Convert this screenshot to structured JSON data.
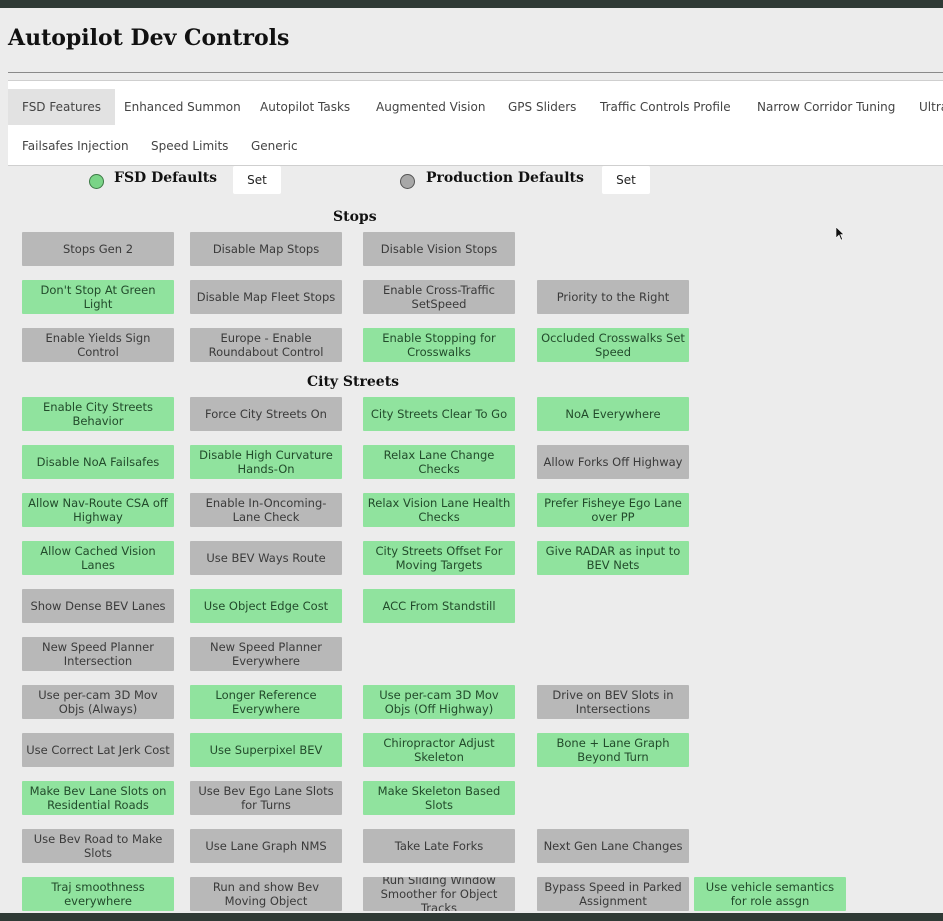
{
  "app": {
    "title": "Autopilot Dev Controls"
  },
  "tabs": [
    "FSD Features",
    "Enhanced Summon",
    "Autopilot Tasks",
    "Augmented Vision",
    "GPS Sliders",
    "Traffic Controls Profile",
    "Narrow Corridor Tuning",
    "Ultra",
    "Failsafes Injection",
    "Speed Limits",
    "Generic"
  ],
  "defaults": {
    "fsd_label": "FSD Defaults",
    "production_label": "Production Defaults",
    "set_label": "Set"
  },
  "sections": {
    "stops": "Stops",
    "city_streets": "City Streets"
  },
  "colors": {
    "enabled": "#90e39e",
    "disabled": "#b8b8b8",
    "accent": "#7ad487"
  },
  "buttons": [
    {
      "label": "Stops Gen 2",
      "enabled": false
    },
    {
      "label": "Disable Map Stops",
      "enabled": false
    },
    {
      "label": "Disable Vision Stops",
      "enabled": false
    },
    {
      "label": "Don't Stop At Green Light",
      "enabled": true
    },
    {
      "label": "Disable Map Fleet Stops",
      "enabled": false
    },
    {
      "label": "Enable Cross-Traffic SetSpeed",
      "enabled": false
    },
    {
      "label": "Priority to the Right",
      "enabled": false
    },
    {
      "label": "Enable Yields Sign Control",
      "enabled": false
    },
    {
      "label": "Europe - Enable Roundabout Control",
      "enabled": false
    },
    {
      "label": "Enable Stopping for Crosswalks",
      "enabled": true
    },
    {
      "label": "Occluded Crosswalks Set Speed",
      "enabled": true
    },
    {
      "label": "Enable City Streets Behavior",
      "enabled": true
    },
    {
      "label": "Force City Streets On",
      "enabled": false
    },
    {
      "label": "City Streets Clear To Go",
      "enabled": true
    },
    {
      "label": "NoA Everywhere",
      "enabled": true
    },
    {
      "label": "Disable NoA Failsafes",
      "enabled": true
    },
    {
      "label": "Disable High Curvature Hands-On",
      "enabled": true
    },
    {
      "label": "Relax Lane Change Checks",
      "enabled": true
    },
    {
      "label": "Allow Forks Off Highway",
      "enabled": false
    },
    {
      "label": "Allow Nav-Route CSA off Highway",
      "enabled": true
    },
    {
      "label": "Enable In-Oncoming-Lane Check",
      "enabled": false
    },
    {
      "label": "Relax Vision Lane Health Checks",
      "enabled": true
    },
    {
      "label": "Prefer Fisheye Ego Lane over PP",
      "enabled": true
    },
    {
      "label": "Allow Cached Vision Lanes",
      "enabled": true
    },
    {
      "label": "Use BEV Ways Route",
      "enabled": false
    },
    {
      "label": "City Streets Offset For Moving Targets",
      "enabled": true
    },
    {
      "label": "Give RADAR as input to BEV Nets",
      "enabled": true
    },
    {
      "label": "Show Dense BEV Lanes",
      "enabled": false
    },
    {
      "label": "Use Object Edge Cost",
      "enabled": true
    },
    {
      "label": "ACC From Standstill",
      "enabled": true
    },
    {
      "label": "New Speed Planner Intersection",
      "enabled": false
    },
    {
      "label": "New Speed Planner Everywhere",
      "enabled": false
    },
    {
      "label": "Use per-cam 3D Mov Objs (Always)",
      "enabled": false
    },
    {
      "label": "Longer Reference Everywhere",
      "enabled": true
    },
    {
      "label": "Use per-cam 3D Mov Objs (Off Highway)",
      "enabled": true
    },
    {
      "label": "Drive on BEV Slots in Intersections",
      "enabled": false
    },
    {
      "label": "Use Correct Lat Jerk Cost",
      "enabled": false
    },
    {
      "label": "Use Superpixel BEV",
      "enabled": true
    },
    {
      "label": "Chiropractor Adjust Skeleton",
      "enabled": true
    },
    {
      "label": "Bone + Lane Graph Beyond Turn",
      "enabled": true
    },
    {
      "label": "Make Bev Lane Slots on Residential Roads",
      "enabled": true
    },
    {
      "label": "Use Bev Ego Lane Slots for Turns",
      "enabled": false
    },
    {
      "label": "Make Skeleton Based Slots",
      "enabled": true
    },
    {
      "label": "Use Bev Road to Make Slots",
      "enabled": false
    },
    {
      "label": "Use Lane Graph NMS",
      "enabled": false
    },
    {
      "label": "Take Late Forks",
      "enabled": false
    },
    {
      "label": "Next Gen Lane Changes",
      "enabled": false
    },
    {
      "label": "Traj smoothness everywhere",
      "enabled": true
    },
    {
      "label": "Run and show Bev Moving Object",
      "enabled": false
    },
    {
      "label": "Run Sliding Window Smoother for Object Tracks",
      "enabled": false
    },
    {
      "label": "Bypass Speed in Parked Assignment",
      "enabled": false
    },
    {
      "label": "Use vehicle semantics for role assgn",
      "enabled": true
    }
  ]
}
